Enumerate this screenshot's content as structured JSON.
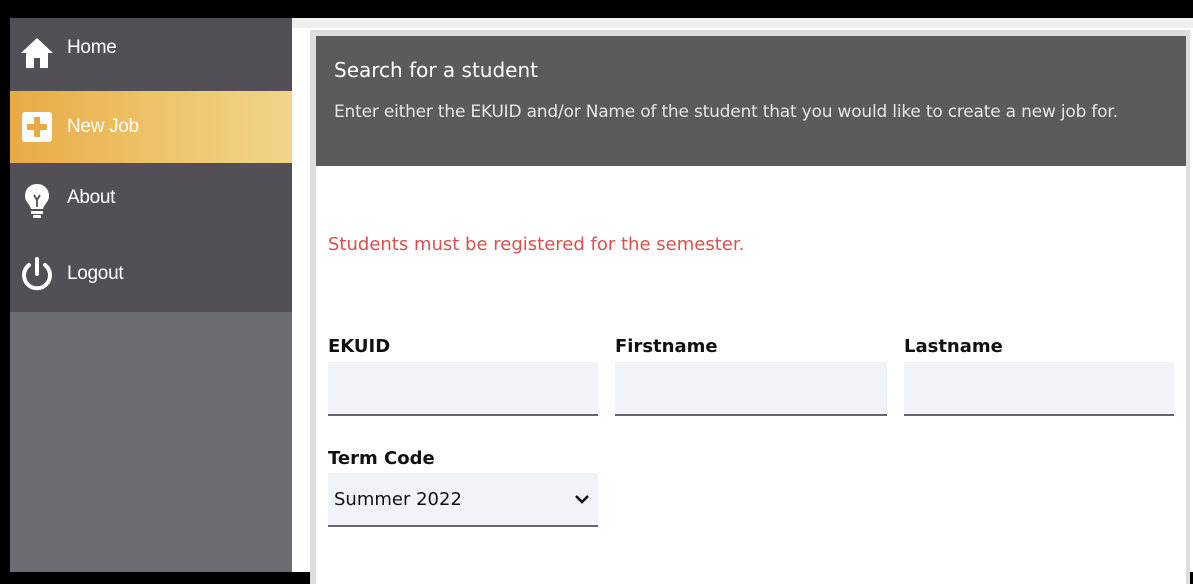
{
  "sidebar": {
    "items": [
      {
        "label": "Home",
        "icon": "home-icon",
        "active": false
      },
      {
        "label": "New Job",
        "icon": "plus-icon",
        "active": true
      },
      {
        "label": "About",
        "icon": "lightbulb-icon",
        "active": false
      },
      {
        "label": "Logout",
        "icon": "power-icon",
        "active": false
      }
    ],
    "active_color": "#e9aa43"
  },
  "card": {
    "title": "Search for a student",
    "description": "Enter either the EKUID and/or Name of the student that you would like to create a new job for."
  },
  "warning": "Students must be registered for the semester.",
  "form": {
    "ekuid_label": "EKUID",
    "ekuid_value": "",
    "firstname_label": "Firstname",
    "firstname_value": "",
    "lastname_label": "Lastname",
    "lastname_value": "",
    "term_label": "Term Code",
    "term_selected": "Summer 2022"
  },
  "colors": {
    "warning": "#d94f4f",
    "header_bg": "#5c5a5c",
    "sidebar_bg": "#525056"
  }
}
